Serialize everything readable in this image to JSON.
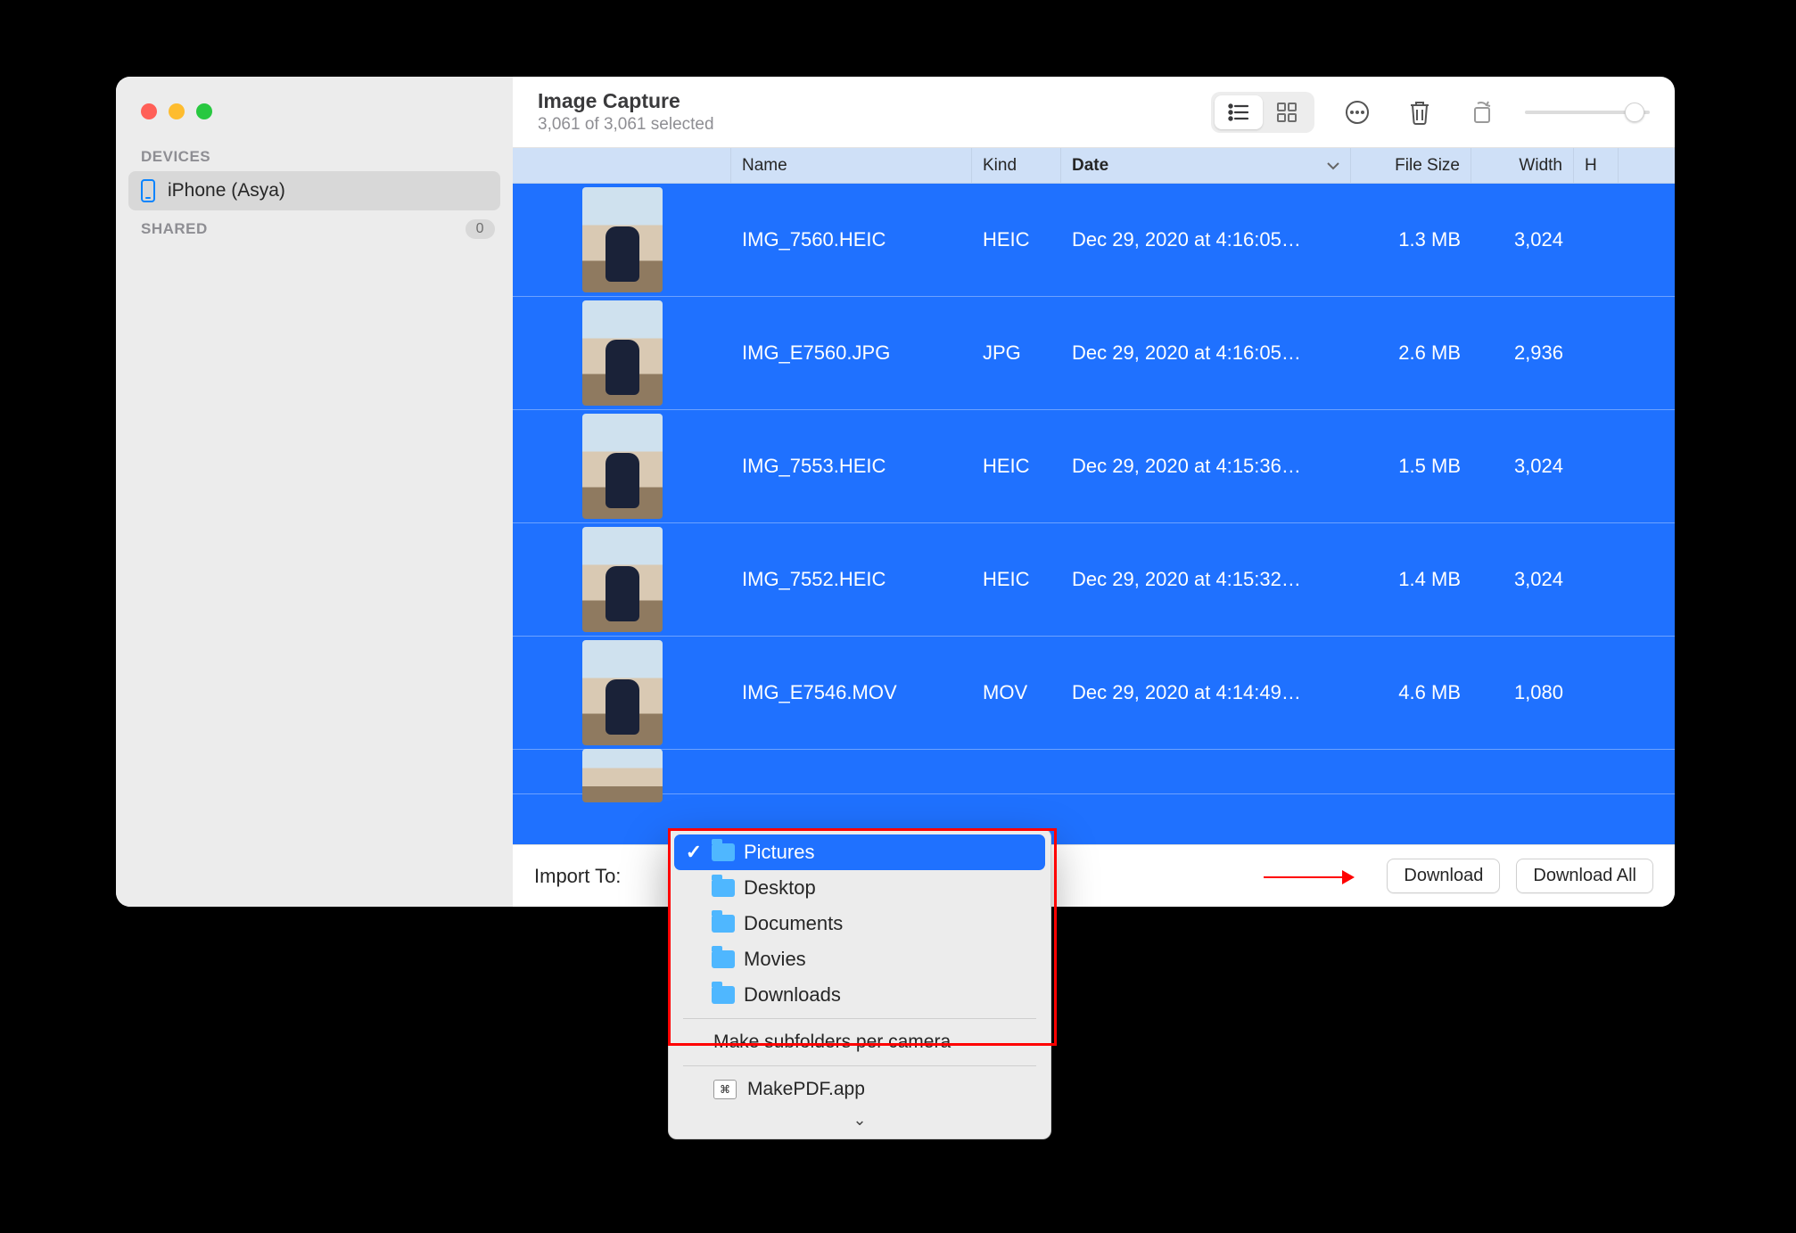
{
  "window": {
    "title": "Image Capture",
    "subtitle": "3,061 of 3,061 selected"
  },
  "sidebar": {
    "devices_heading": "DEVICES",
    "shared_heading": "SHARED",
    "shared_count": "0",
    "device": "iPhone (Asya)"
  },
  "columns": {
    "name": "Name",
    "kind": "Kind",
    "date": "Date",
    "size": "File Size",
    "width": "Width",
    "h": "H"
  },
  "rows": [
    {
      "name": "IMG_7560.HEIC",
      "kind": "HEIC",
      "date": "Dec 29, 2020 at 4:16:05…",
      "size": "1.3 MB",
      "width": "3,024"
    },
    {
      "name": "IMG_E7560.JPG",
      "kind": "JPG",
      "date": "Dec 29, 2020 at 4:16:05…",
      "size": "2.6 MB",
      "width": "2,936"
    },
    {
      "name": "IMG_7553.HEIC",
      "kind": "HEIC",
      "date": "Dec 29, 2020 at 4:15:36…",
      "size": "1.5 MB",
      "width": "3,024"
    },
    {
      "name": "IMG_7552.HEIC",
      "kind": "HEIC",
      "date": "Dec 29, 2020 at 4:15:32…",
      "size": "1.4 MB",
      "width": "3,024"
    },
    {
      "name": "IMG_E7546.MOV",
      "kind": "MOV",
      "date": "Dec 29, 2020 at 4:14:49…",
      "size": "4.6 MB",
      "width": "1,080"
    }
  ],
  "footer": {
    "import_label": "Import To:",
    "download": "Download",
    "download_all": "Download All"
  },
  "dropdown": {
    "items": [
      "Pictures",
      "Desktop",
      "Documents",
      "Movies",
      "Downloads"
    ],
    "subfolders": "Make subfolders per camera",
    "app": "MakePDF.app"
  }
}
